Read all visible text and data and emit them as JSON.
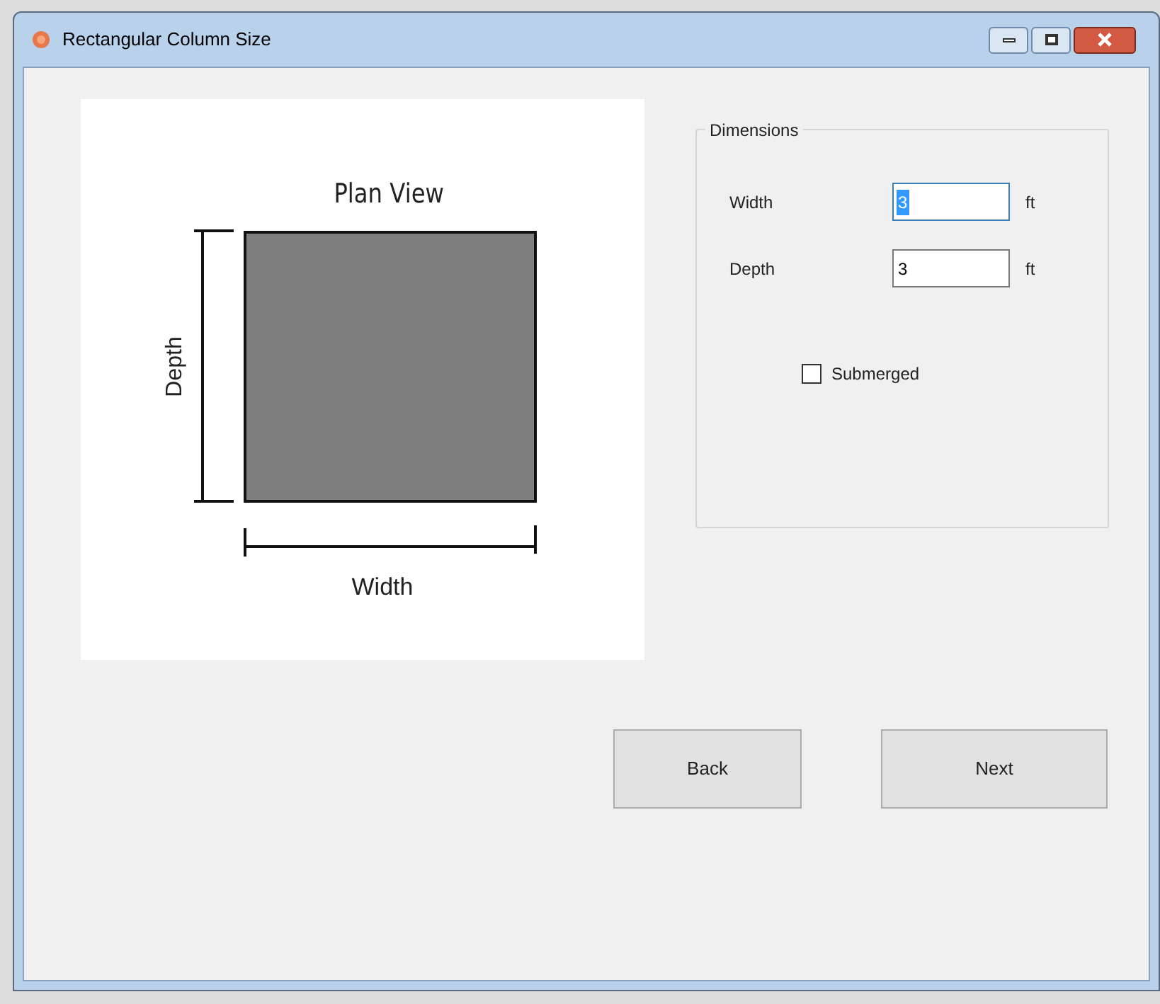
{
  "window": {
    "title": "Rectangular Column Size"
  },
  "diagram": {
    "title": "Plan View",
    "depth_label": "Depth",
    "width_label": "Width"
  },
  "dimensions": {
    "title": "Dimensions",
    "fields": [
      {
        "label": "Width",
        "value": "3",
        "unit": "ft",
        "focused": true
      },
      {
        "label": "Depth",
        "value": "3",
        "unit": "ft",
        "focused": false
      }
    ],
    "submerged": {
      "label": "Submerged",
      "checked": false
    }
  },
  "buttons": [
    "Back",
    "Next"
  ]
}
